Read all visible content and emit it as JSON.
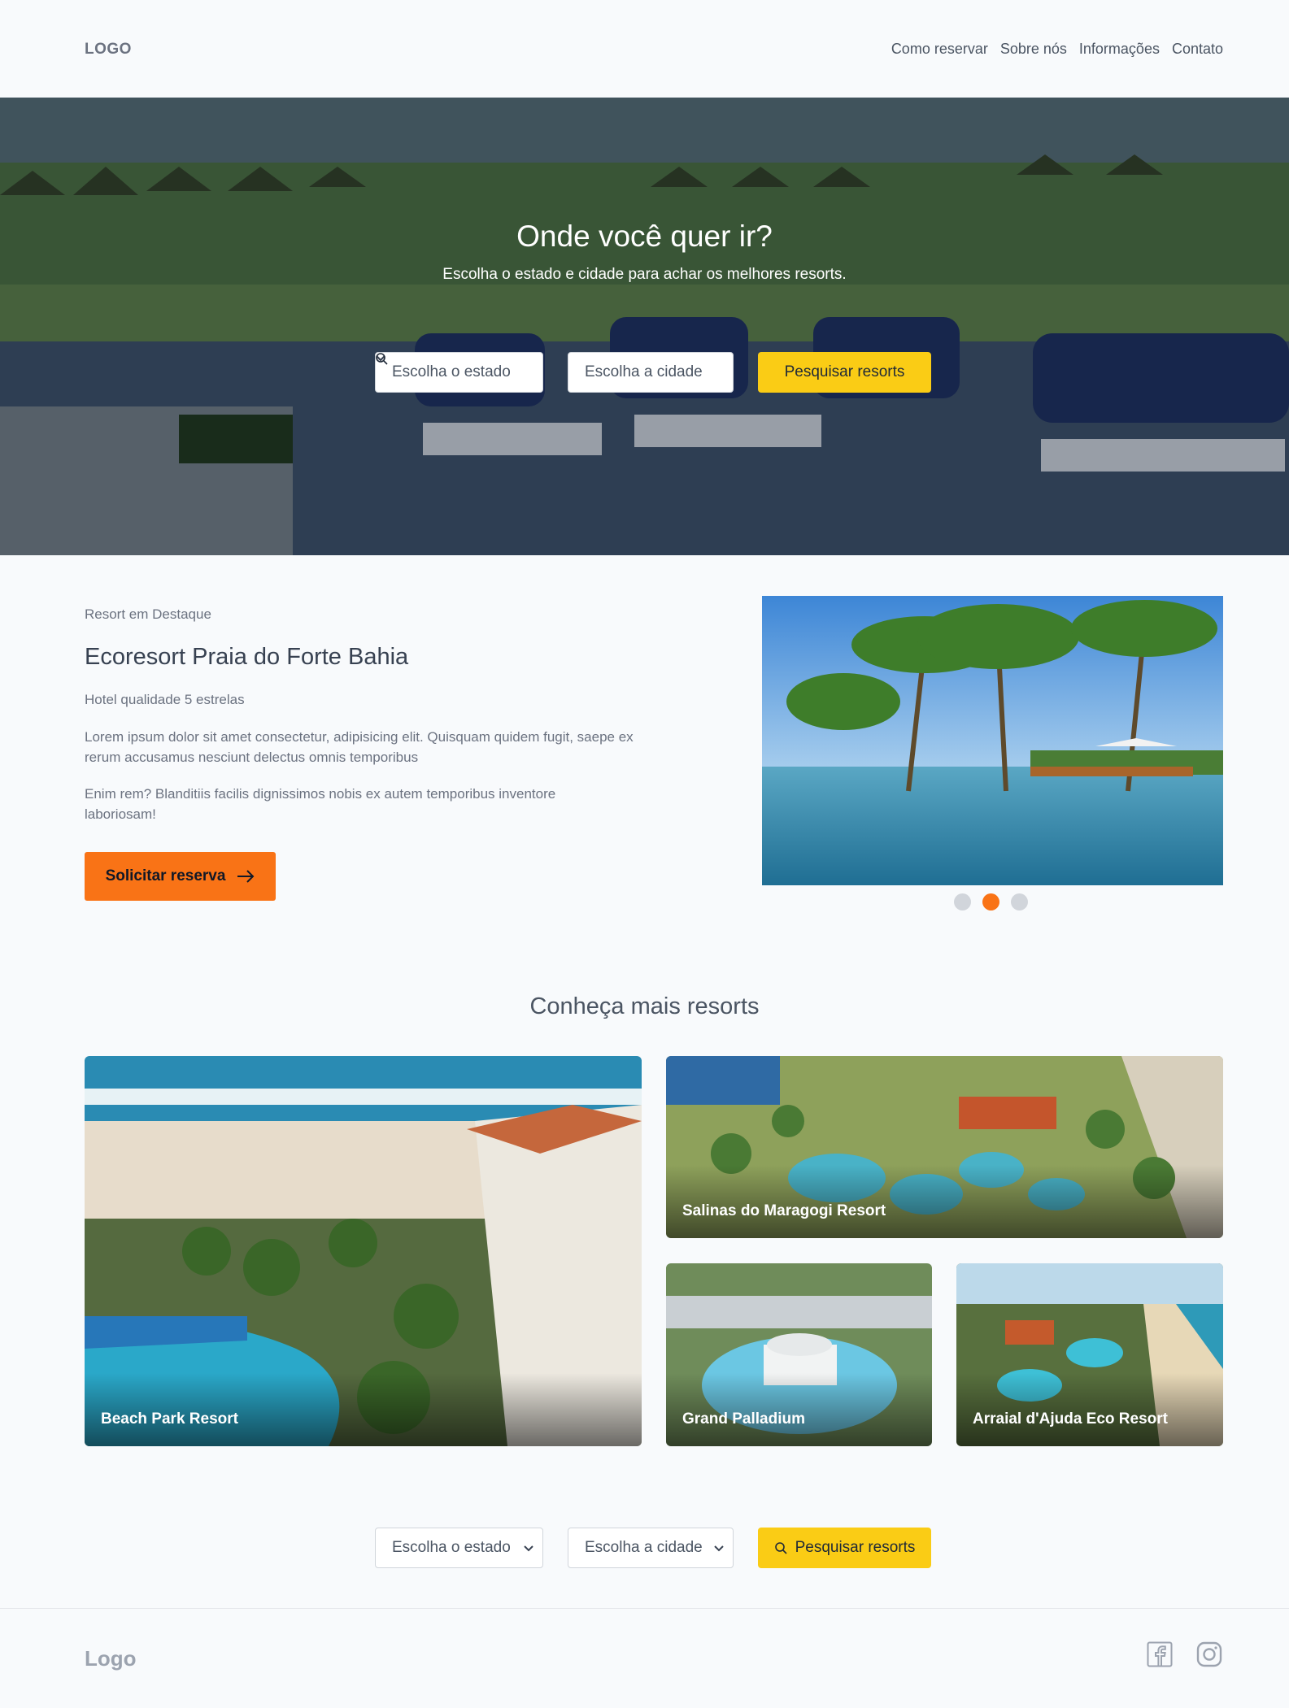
{
  "header": {
    "logo": "LOGO",
    "nav": [
      "Como reservar",
      "Sobre nós",
      "Informações",
      "Contato"
    ]
  },
  "hero": {
    "title": "Onde você quer ir?",
    "subtitle": "Escolha o estado e cidade para achar os melhores resorts.",
    "state_select": "Escolha o estado",
    "city_select": "Escolha a cidade",
    "search_button": "Pesquisar resorts"
  },
  "featured": {
    "kicker": "Resort em Destaque",
    "title": "Ecoresort Praia do Forte Bahia",
    "subtitle": "Hotel qualidade 5 estrelas",
    "paragraph1": "Lorem ipsum dolor sit amet consectetur, adipisicing elit. Quisquam quidem fugit, saepe ex rerum accusamus nesciunt delectus omnis temporibus",
    "paragraph2": "Enim rem? Blanditiis facilis dignissimos nobis ex autem temporibus inventore laboriosam!",
    "cta": "Solicitar reserva",
    "carousel_active_index": 2,
    "carousel_count": 3
  },
  "more": {
    "title": "Conheça mais resorts",
    "cards": [
      "Beach Park Resort",
      "Salinas do Maragogi Resort",
      "Grand Palladium",
      "Arraial d'Ajuda Eco Resort"
    ]
  },
  "bottom_search": {
    "state_select": "Escolha o estado",
    "city_select": "Escolha a cidade",
    "search_button": "Pesquisar resorts"
  },
  "footer": {
    "logo": "Logo",
    "social": [
      "facebook-icon",
      "instagram-icon"
    ]
  },
  "colors": {
    "accent_orange": "#f97316",
    "accent_yellow": "#facc15",
    "background": "#f8fafc"
  }
}
